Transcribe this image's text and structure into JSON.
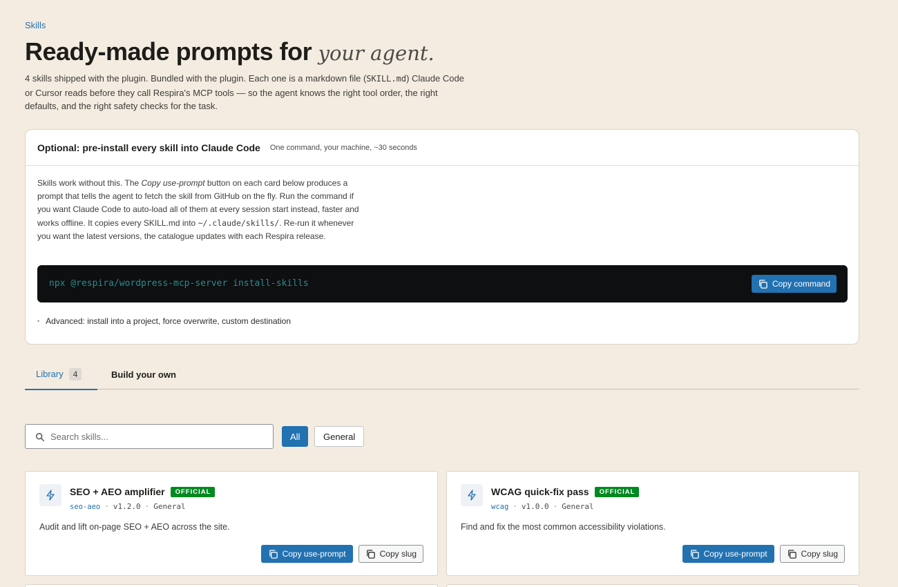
{
  "header": {
    "eyebrow": "Skills",
    "title_main": "Ready-made prompts for ",
    "title_accent": "your agent.",
    "intro_before_code": "4 skills shipped with the plugin. Bundled with the plugin. Each one is a markdown file (",
    "intro_code": "SKILL.md",
    "intro_after_code": ") Claude Code or Cursor reads before they call Respira's MCP tools — so the agent knows the right tool order, the right defaults, and the right safety checks for the task."
  },
  "install_panel": {
    "title": "Optional: pre-install every skill into Claude Code",
    "subtitle": "One command, your machine, ~30 seconds",
    "body_part1": "Skills work without this. The ",
    "body_em": "Copy use-prompt",
    "body_part2": " button on each card below produces a prompt that tells the agent to fetch the skill from GitHub on the fly. Run the command if you want Claude Code to auto-load all of them at every session start instead, faster and works offline. It copies every SKILL.md into ",
    "body_code": "~/.claude/skills/",
    "body_part3": ". Re-run it whenever you want the latest versions, the catalogue updates with each Respira release.",
    "command": "npx @respira/wordpress-mcp-server install-skills",
    "copy_command_label": "Copy command",
    "advanced_label": "Advanced: install into a project, force overwrite, custom destination"
  },
  "tabs": {
    "library_label": "Library",
    "library_count": "4",
    "build_label": "Build your own"
  },
  "search": {
    "placeholder": "Search skills..."
  },
  "filters": {
    "all": "All",
    "general": "General"
  },
  "cards": [
    {
      "name": "SEO + AEO amplifier",
      "badge": "OFFICIAL",
      "slug": "seo-aeo",
      "version": "v1.2.0",
      "category": "General",
      "description": "Audit and lift on-page SEO + AEO across the site.",
      "copy_prompt_label": "Copy use-prompt",
      "copy_slug_label": "Copy slug"
    },
    {
      "name": "WCAG quick-fix pass",
      "badge": "OFFICIAL",
      "slug": "wcag",
      "version": "v1.0.0",
      "category": "General",
      "description": "Find and fix the most common accessibility violations.",
      "copy_prompt_label": "Copy use-prompt",
      "copy_slug_label": "Copy slug"
    }
  ],
  "colors": {
    "background": "#f4ece0",
    "accent": "#2271b1",
    "official_badge": "#008a20",
    "command_bg": "#0d0f10"
  },
  "icons": [
    "search-icon",
    "copy-icon",
    "bolt-icon"
  ]
}
